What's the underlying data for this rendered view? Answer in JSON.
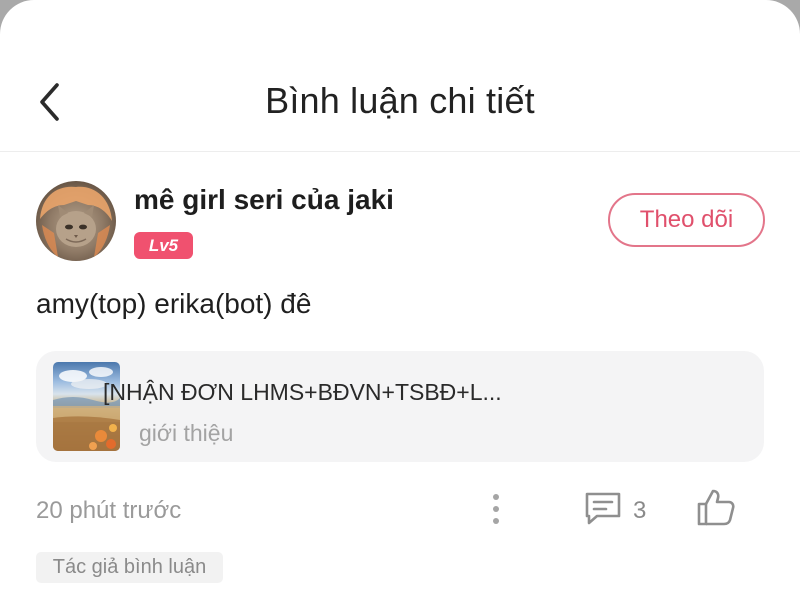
{
  "header": {
    "title": "Bình luận chi tiết",
    "back_icon": "chevron-left-icon"
  },
  "comment": {
    "author": {
      "name": "mê girl seri của jaki",
      "level": "Lv5",
      "avatar": "cat-avatar"
    },
    "follow_label": "Theo dõi",
    "text": "amy(top) erika(bot) đê",
    "post": {
      "title": "[NHẬN ĐƠN LHMS+BĐVN+TSBĐ+L...",
      "subtitle": "giới thiệu"
    },
    "time": "20 phút trước",
    "reply_count": "3",
    "author_tag": "Tác giả bình luận"
  },
  "colors": {
    "accent": "#f0516f",
    "follow_border": "#e3758a",
    "muted_text": "#9a9a9a",
    "card_bg": "#f4f4f5"
  }
}
